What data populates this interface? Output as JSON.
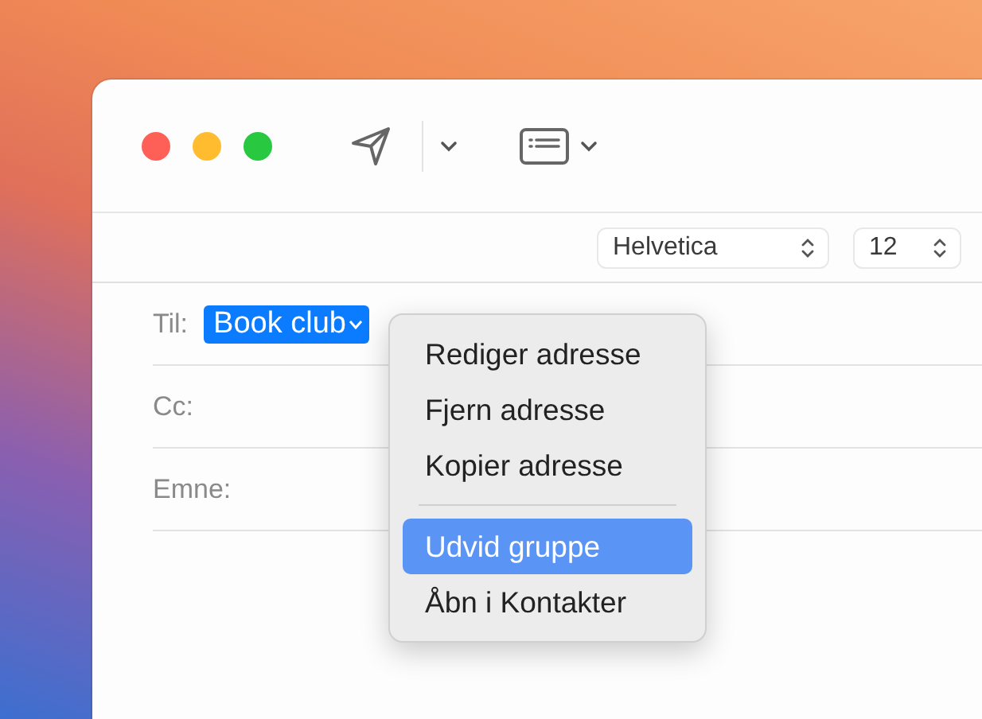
{
  "toolbar": {
    "font_select": {
      "value": "Helvetica"
    },
    "size_select": {
      "value": "12"
    }
  },
  "header_fields": [
    {
      "label": "Til:",
      "tokens": [
        {
          "text": "Book club",
          "selected": true
        }
      ]
    },
    {
      "label": "Cc:"
    },
    {
      "label": "Emne:"
    }
  ],
  "context_menu": {
    "items": [
      {
        "kind": "item",
        "label": "Rediger adresse",
        "selected": false
      },
      {
        "kind": "item",
        "label": "Fjern adresse",
        "selected": false
      },
      {
        "kind": "item",
        "label": "Kopier adresse",
        "selected": false
      },
      {
        "kind": "separator"
      },
      {
        "kind": "item",
        "label": "Udvid gruppe",
        "selected": true
      },
      {
        "kind": "item",
        "label": "Åbn i Kontakter",
        "selected": false
      }
    ]
  }
}
